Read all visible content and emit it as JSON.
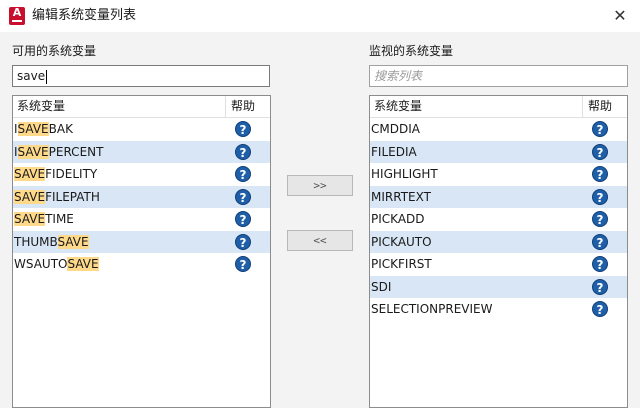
{
  "dialog": {
    "title": "编辑系统变量列表",
    "close_label": "✕"
  },
  "available": {
    "label": "可用的系统变量",
    "search_value": "save",
    "col_name": "系统变量",
    "col_help": "帮助",
    "rows": [
      {
        "pre": "I",
        "hl": "SAVE",
        "post": "BAK"
      },
      {
        "pre": "I",
        "hl": "SAVE",
        "post": "PERCENT"
      },
      {
        "pre": "",
        "hl": "SAVE",
        "post": "FIDELITY"
      },
      {
        "pre": "",
        "hl": "SAVE",
        "post": "FILEPATH"
      },
      {
        "pre": "",
        "hl": "SAVE",
        "post": "TIME"
      },
      {
        "pre": "THUMB",
        "hl": "SAVE",
        "post": ""
      },
      {
        "pre": "WSAUTO",
        "hl": "SAVE",
        "post": ""
      }
    ]
  },
  "monitored": {
    "label": "监视的系统变量",
    "search_placeholder": "搜索列表",
    "col_name": "系统变量",
    "col_help": "帮助",
    "rows": [
      "CMDDIA",
      "FILEDIA",
      "HIGHLIGHT",
      "MIRRTEXT",
      "PICKADD",
      "PICKAUTO",
      "PICKFIRST",
      "SDI",
      "SELECTIONPREVIEW"
    ]
  },
  "buttons": {
    "add": ">>",
    "remove": "<<"
  },
  "icons": {
    "help": "?",
    "app": "A"
  },
  "colors": {
    "highlight": "#ffd98a",
    "row_alt": "#d8e6f5",
    "help_icon": "#1f5fa8",
    "brand": "#c8102e"
  }
}
